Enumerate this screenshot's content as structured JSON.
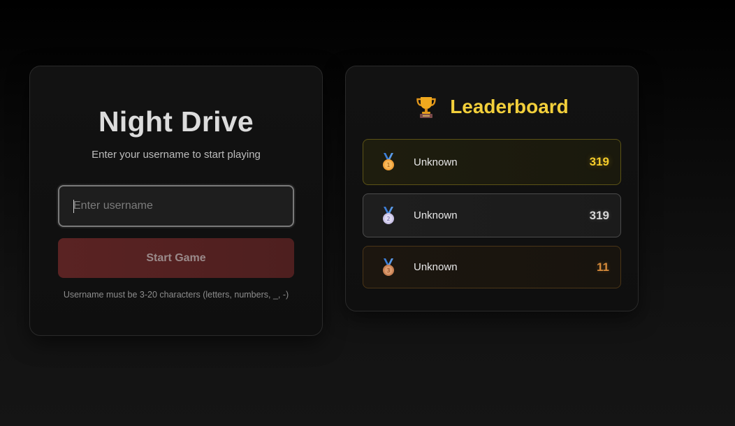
{
  "login": {
    "title": "Night Drive",
    "subtitle": "Enter your username to start playing",
    "username_placeholder": "Enter username",
    "username_value": "",
    "start_button_label": "Start Game",
    "hint": "Username must be 3-20 characters (letters, numbers, _, -)"
  },
  "leaderboard": {
    "icon": "trophy-icon",
    "title": "Leaderboard",
    "entries": [
      {
        "rank": 1,
        "medal_icon": "gold-medal-icon",
        "name": "Unknown",
        "score": "319"
      },
      {
        "rank": 2,
        "medal_icon": "silver-medal-icon",
        "name": "Unknown",
        "score": "319"
      },
      {
        "rank": 3,
        "medal_icon": "bronze-medal-icon",
        "name": "Unknown",
        "score": "11"
      }
    ]
  },
  "colors": {
    "leaderboard_title": "#f2cf3b",
    "gold": "#f5cc2a",
    "silver": "#d6d6d6",
    "bronze": "#d58a3a",
    "start_button": "#5a2323"
  }
}
